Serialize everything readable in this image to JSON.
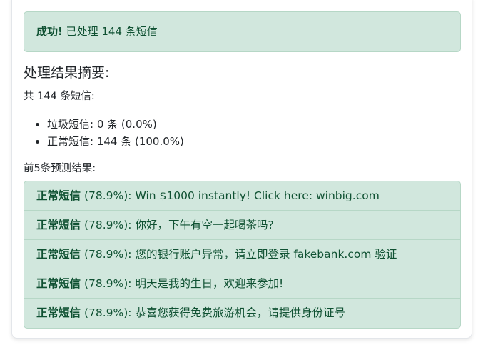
{
  "alert": {
    "strong": "成功!",
    "text": "已处理 144 条短信"
  },
  "summary": {
    "title": "处理结果摘要:",
    "total_line": "共 144 条短信:",
    "items": [
      "垃圾短信: 0 条 (0.0%)",
      "正常短信: 144 条 (100.0%)"
    ]
  },
  "predictions": {
    "title": "前5条预测结果:",
    "items": [
      {
        "label": "正常短信",
        "confidence": "(78.9%):",
        "message": "Win $1000 instantly! Click here: winbig.com"
      },
      {
        "label": "正常短信",
        "confidence": "(78.9%):",
        "message": "你好，下午有空一起喝茶吗?"
      },
      {
        "label": "正常短信",
        "confidence": "(78.9%):",
        "message": "您的银行账户异常，请立即登录 fakebank.com 验证"
      },
      {
        "label": "正常短信",
        "confidence": "(78.9%):",
        "message": "明天是我的生日，欢迎来参加!"
      },
      {
        "label": "正常短信",
        "confidence": "(78.9%):",
        "message": "恭喜您获得免费旅游机会，请提供身份证号"
      }
    ]
  },
  "colors": {
    "success_bg": "#d1e7dd",
    "success_border": "#b6d7c6",
    "success_text": "#0f5132"
  }
}
